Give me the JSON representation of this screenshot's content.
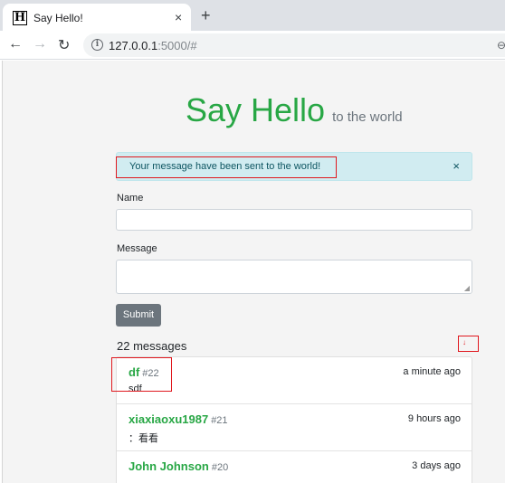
{
  "browser": {
    "tab_title": "Say Hello!",
    "favicon_letter": "H",
    "tab_close": "×",
    "new_tab": "+",
    "url_host": "127.0.0.1",
    "url_rest": ":5000/#",
    "back": "←",
    "forward": "→",
    "reload": "↻",
    "info": "i",
    "right_icon": "⊖"
  },
  "page": {
    "title": "Say Hello",
    "subtitle": "to the world",
    "alert": {
      "text": "Your message have been sent to the world!",
      "close": "×"
    },
    "form": {
      "name_label": "Name",
      "name_value": "",
      "message_label": "Message",
      "message_value": "",
      "submit_label": "Submit"
    },
    "messages_count": "22 messages",
    "scroll_arrow": "↓",
    "messages": [
      {
        "name": "df",
        "number": "#22",
        "time": "a minute ago",
        "body": "sdf"
      },
      {
        "name": "xiaxiaoxu1987",
        "number": "#21",
        "time": "9 hours ago",
        "body": "：看看"
      },
      {
        "name": "John Johnson",
        "number": "#20",
        "time": "3 days ago",
        "body": ""
      }
    ]
  },
  "colors": {
    "accent": "#28a745",
    "alert_bg": "#d1ecf1",
    "alert_text": "#0c5460",
    "button_bg": "#6c757d",
    "highlight_red": "#e0181e"
  }
}
